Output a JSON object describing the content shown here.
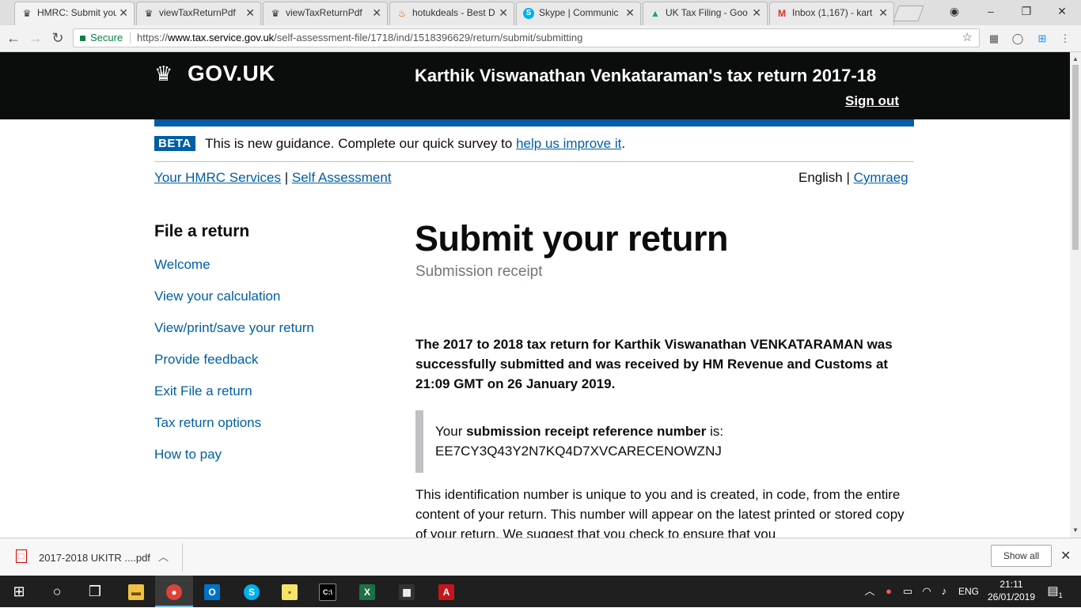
{
  "browser": {
    "tabs": [
      {
        "title": "HMRC: Submit you",
        "icon": "crown-icon",
        "active": true
      },
      {
        "title": "viewTaxReturnPdf",
        "icon": "crown-icon"
      },
      {
        "title": "viewTaxReturnPdf",
        "icon": "crown-icon"
      },
      {
        "title": "hotukdeals - Best D",
        "icon": "flame-icon"
      },
      {
        "title": "Skype | Communic",
        "icon": "skype-icon"
      },
      {
        "title": "UK Tax Filing - Goo",
        "icon": "drive-icon"
      },
      {
        "title": "Inbox (1,167) - kart",
        "icon": "gmail-icon"
      }
    ],
    "secure_label": "Secure",
    "url_prefix": "https://",
    "url_host": "www.tax.service.gov.uk",
    "url_path": "/self-assessment-file/1718/ind/1518396629/return/submit/submitting"
  },
  "header": {
    "logo_text": "GOV.UK",
    "service_title": "Karthik Viswanathan Venkataraman's tax return 2017-18",
    "sign_out": "Sign out"
  },
  "beta": {
    "tag": "BETA",
    "text": "This is new guidance. Complete our quick survey to",
    "link": "help us improve it",
    "suffix": "."
  },
  "breadcrumbs": {
    "first": "Your HMRC Services",
    "separator": "|",
    "second": "Self Assessment"
  },
  "language": {
    "current": "English",
    "separator": "|",
    "other": "Cymraeg"
  },
  "sidebar": {
    "title": "File a return",
    "links": [
      "Welcome",
      "View your calculation",
      "View/print/save your return",
      "Provide feedback",
      "Exit File a return",
      "Tax return options",
      "How to pay"
    ]
  },
  "main": {
    "title": "Submit your return",
    "subtitle": "Submission receipt",
    "summary": "The 2017 to 2018 tax return for Karthik Viswanathan VENKATARAMAN was successfully submitted and was received by HM Revenue and Customs at 21:09 GMT on 26 January 2019.",
    "inset_pre": "Your",
    "inset_bold": "submission receipt reference number",
    "inset_post": "is:",
    "reference": "EE7CY3Q43Y2N7KQ4D7XVCARECENOWZNJ",
    "paragraph": "This identification number is unique to you and is created, in code, from the entire content of your return. This number will appear on the latest printed or stored copy of your return. We suggest that you check to ensure that you"
  },
  "downloads": {
    "file_name": "2017-2018 UKITR ....pdf",
    "show_all": "Show all"
  },
  "taskbar": {
    "language": "ENG",
    "time": "21:11",
    "date": "26/01/2019",
    "notification_count": "1"
  }
}
